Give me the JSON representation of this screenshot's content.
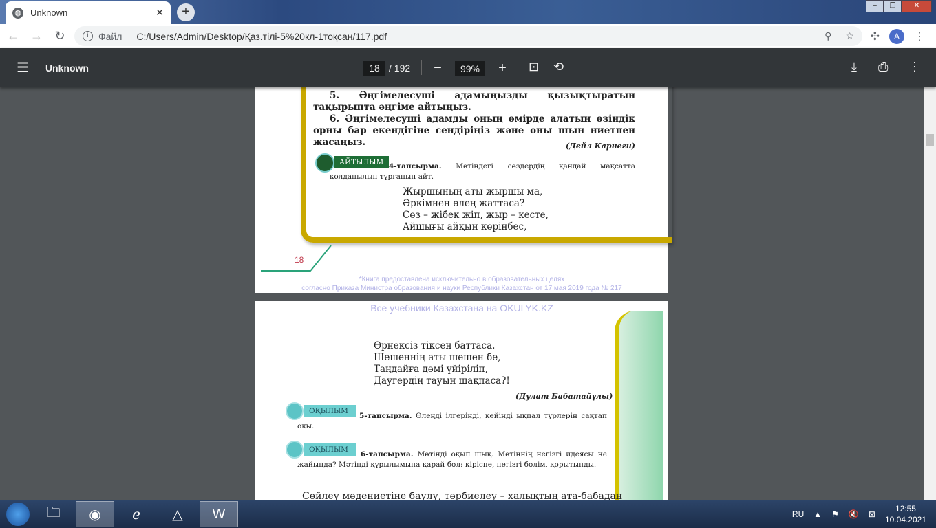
{
  "browser": {
    "tab_title": "Unknown",
    "address_label": "Файл",
    "url": "C:/Users/Admin/Desktop/Қаз.тілі-5%20кл-1тоқсан/117.pdf",
    "avatar_letter": "A"
  },
  "pdf_toolbar": {
    "title": "Unknown",
    "current_page": "18",
    "total_pages": "/ 192",
    "zoom": "99%"
  },
  "page1": {
    "item5": "5. Әңгімелесуші адамыңызды қызықтыратын тақырыпта әңгіме айтыңыз.",
    "item6": "6. Әңгімелесуші адамды оның өмірде алатын өзіндік орны бар екендігіне сендіріңіз және оны шын ниетпен жасаңыз.",
    "author": "(Дейл Карнеги)",
    "badge": "АЙТЫЛЫМ",
    "task_num": "4-тапсырма.",
    "task_text": " Мәтіндегі сөздердің қандай мақсатта қолданылып тұрғанын айт.",
    "poem": [
      "Жыршының аты жыршы ма,",
      "Әркімнен өлең жаттаса?",
      "Сөз – жібек жіп, жыр – кесте,",
      "Айшығы айқын көрінбес,"
    ],
    "page_number": "18",
    "watermark1": "*Книга предоставлена исключительно в образовательных целях",
    "watermark2": "согласно Приказа Министра образования и науки Республики Казахстан от 17 мая 2019 года № 217"
  },
  "page2": {
    "watermark": "Все учебники Казахстана на OKULYK.KZ",
    "poem": [
      "Өрнексіз тіксең баттаса.",
      "Шешеннің аты шешен бе,",
      "Таңдайға дәмі үйіріліп,",
      "Даугердің тауын шақпаса?!"
    ],
    "author": "(Дулат Бабатайұлы)",
    "badge5": "ОҚЫЛЫМ",
    "task5_num": "5-тапсырма.",
    "task5_text": " Өлеңді ілгерінді, кейінді ықпал түрлерін сақтап оқы.",
    "badge6": "ОҚЫЛЫМ",
    "task6_num": "6-тапсырма.",
    "task6_text": " Мәтінді оқып шық. Мәтіннің негізгі идеясы не жайында? Мәтінді құрылымына қарай бөл: кіріспе, негізгі бөлім, қорытынды.",
    "body": "Сөйлеу мәдениетіне баулу, тәрбиелеу – халықтың ата-бабадан"
  },
  "taskbar": {
    "lang": "RU",
    "time": "12:55",
    "date": "10.04.2021"
  }
}
